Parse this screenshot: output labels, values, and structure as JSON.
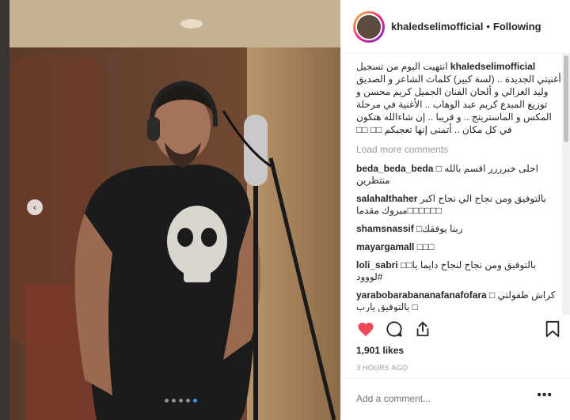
{
  "post": {
    "username": "khaledselimofficial",
    "separator": "•",
    "follow_status": "Following",
    "caption": "انتهيت اليوم من تسجيل أغنيتي الجديدة .. (لسة كبير) كلمات الشاعر و الصديق وليد الغزالي و ألحان الفنان الجميل كريم محسن و توزيع المبدع كريم عبد الوهاب .. الأغنية في مرحلة المكس و الماسترينج .. و قريبا .. إن شاءالله هتكون في كل مكان .. أتمنى إنها تعجبكم □□ □□",
    "load_more": "Load more comments",
    "comments": [
      {
        "user": "beda_beda_beda",
        "text": "□ احلى خبرررر اقسم بالله منتظرين"
      },
      {
        "user": "salahalthaher",
        "text": "بالتوفيق ومن نجاح الي نجاح اكبر □□□□□□مبروك مقدما"
      },
      {
        "user": "shamsnassif",
        "text": "□ربنا يوفقك"
      },
      {
        "user": "mayargamall",
        "text": "□□□"
      },
      {
        "user": "loli_sabri",
        "text": "□□بالتوفيق ومن نجاح لنجاح دايما يا #لووود"
      },
      {
        "user": "yarabobarabananafanafofara",
        "text": "□ كراش طفولتي □ بالتوفيق يارب"
      }
    ],
    "likes": "1,901 likes",
    "time": "3 HOURS AGO",
    "add_comment_placeholder": "Add a comment...",
    "more_label": "•••"
  },
  "carousel": {
    "prev_label": "‹",
    "dot_count": 5,
    "active_dot": 4
  },
  "colors": {
    "like": "#ed4956",
    "link": "#3897f0",
    "text": "#262626",
    "muted": "#999999"
  },
  "icons": [
    "heart-icon",
    "comment-icon",
    "share-icon",
    "bookmark-icon",
    "chevron-left-icon",
    "more-icon"
  ]
}
